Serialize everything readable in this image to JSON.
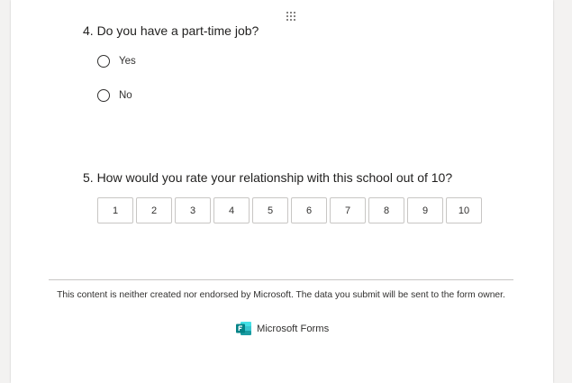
{
  "questions": [
    {
      "number_title": "4. Do you have a part-time job?",
      "options": [
        {
          "label": "Yes"
        },
        {
          "label": "No"
        }
      ]
    },
    {
      "number_title": "5. How would you rate your relationship with this school out of 10?",
      "rating_values": [
        "1",
        "2",
        "3",
        "4",
        "5",
        "6",
        "7",
        "8",
        "9",
        "10"
      ]
    }
  ],
  "footer": {
    "disclaimer": "This content is neither created nor endorsed by Microsoft. The data you submit will be sent to the form owner.",
    "brand_label": "Microsoft Forms",
    "brand_icon": "microsoft-forms-icon",
    "brand_color": "#038387"
  },
  "icons": {
    "drag_handle": "drag-handle-icon"
  }
}
